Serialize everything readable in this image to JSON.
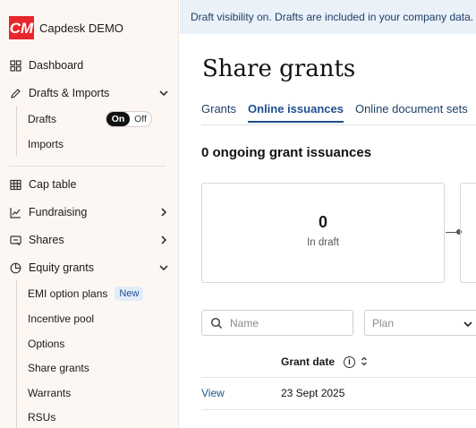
{
  "brand": {
    "name": "Capdesk DEMO",
    "logo_text": "CM",
    "logo_color": "#e8262d"
  },
  "banner": {
    "text": "Draft visibility on. Drafts are included in your company data."
  },
  "sidebar": {
    "dashboard": "Dashboard",
    "drafts_imports": "Drafts & Imports",
    "drafts": "Drafts",
    "toggle_on": "On",
    "toggle_off": "Off",
    "imports": "Imports",
    "cap_table": "Cap table",
    "fundraising": "Fundraising",
    "shares": "Shares",
    "equity_grants": "Equity grants",
    "emi": "EMI option plans",
    "emi_badge": "New",
    "incentive_pool": "Incentive pool",
    "options": "Options",
    "share_grants": "Share grants",
    "warrants": "Warrants",
    "rsus": "RSUs"
  },
  "main": {
    "title": "Share grants",
    "tabs": [
      "Grants",
      "Online issuances",
      "Online document sets"
    ],
    "active_tab": 1,
    "ongoing": "0 ongoing grant issuances",
    "card": {
      "value": "0",
      "label": "In draft"
    },
    "search_placeholder": "Name",
    "plan_placeholder": "Plan",
    "column_grant_date": "Grant date",
    "row": {
      "action": "View",
      "grant_date": "23 Sept 2025"
    }
  },
  "colors": {
    "accent": "#1f4f8f",
    "sidebar_bg": "#fdf7f4",
    "banner_bg": "#eaf1f9"
  }
}
